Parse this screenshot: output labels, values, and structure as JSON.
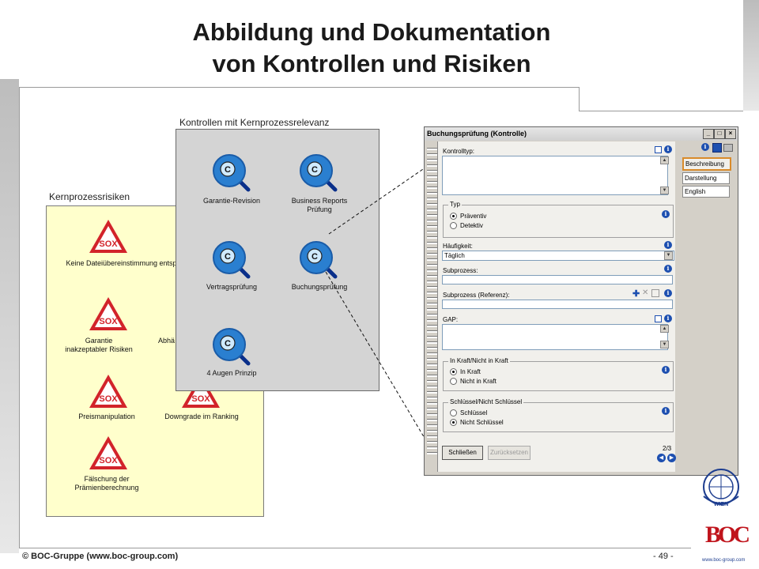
{
  "slide": {
    "title_line1": "Abbildung und Dokumentation",
    "title_line2": "von Kontrollen und Risiken",
    "footer_copyright": "© BOC-Gruppe  (www.boc-group.com)",
    "page_number": "- 49 -"
  },
  "risks": {
    "label": "Kernprozessrisiken",
    "sox_text": "SOX",
    "items": [
      {
        "label": "Keine Dateiübereinstimmung entspr"
      },
      {
        "label": "Garantie inakzeptabler Risiken"
      },
      {
        "label": "Abhä"
      },
      {
        "label": "Preismanipulation"
      },
      {
        "label": "Downgrade im Ranking"
      },
      {
        "label": "Fälschung der Prämienberechnung"
      }
    ]
  },
  "controls": {
    "label": "Kontrollen mit Kernprozessrelevanz",
    "icon_letter": "C",
    "items": [
      {
        "label": "Garantie-Revision"
      },
      {
        "label": "Business Reports Prüfung"
      },
      {
        "label": "Vertragsprüfung"
      },
      {
        "label": "Buchungsprüfung"
      },
      {
        "label": "4 Augen Prinzip"
      }
    ]
  },
  "dialog": {
    "title": "Buchungsprüfung (Kontrolle)",
    "min_btn": "_",
    "max_btn": "□",
    "close_btn": "×",
    "info_glyph": "i",
    "fields": {
      "kontrolltyp": "Kontrolltyp:",
      "typ_group": "Typ",
      "typ_praeventiv": "Präventiv",
      "typ_detektiv": "Detektiv",
      "haeufigkeit": "Häufigkeit:",
      "haeufigkeit_value": "Täglich",
      "subprozess": "Subprozess:",
      "subprozess_ref": "Subprozess (Referenz):",
      "gap": "GAP:",
      "kraft_group": "In Kraft/Nicht in Kraft",
      "kraft_in": "In Kraft",
      "kraft_nicht": "Nicht in Kraft",
      "schluessel_group": "Schlüssel/Nicht Schlüssel",
      "schluessel": "Schlüssel",
      "nicht_schluessel": "Nicht Schlüssel"
    },
    "page_indicator": "2/3",
    "close_button": "Schließen",
    "reset_button": "Zurücksetzen",
    "tabs": [
      "Beschreibung",
      "Darstellung",
      "English"
    ]
  },
  "logo": {
    "emblem_text": "WIEN",
    "brand": "BOC",
    "url": "www.boc-group.com"
  },
  "colors": {
    "risk_panel_bg": "#ffffcc",
    "control_panel_bg": "#d4d4d4",
    "sox_red": "#d2232a",
    "control_blue": "#2a7fd0",
    "brand_red": "#c0141c",
    "brand_blue": "#1d3d8f"
  }
}
